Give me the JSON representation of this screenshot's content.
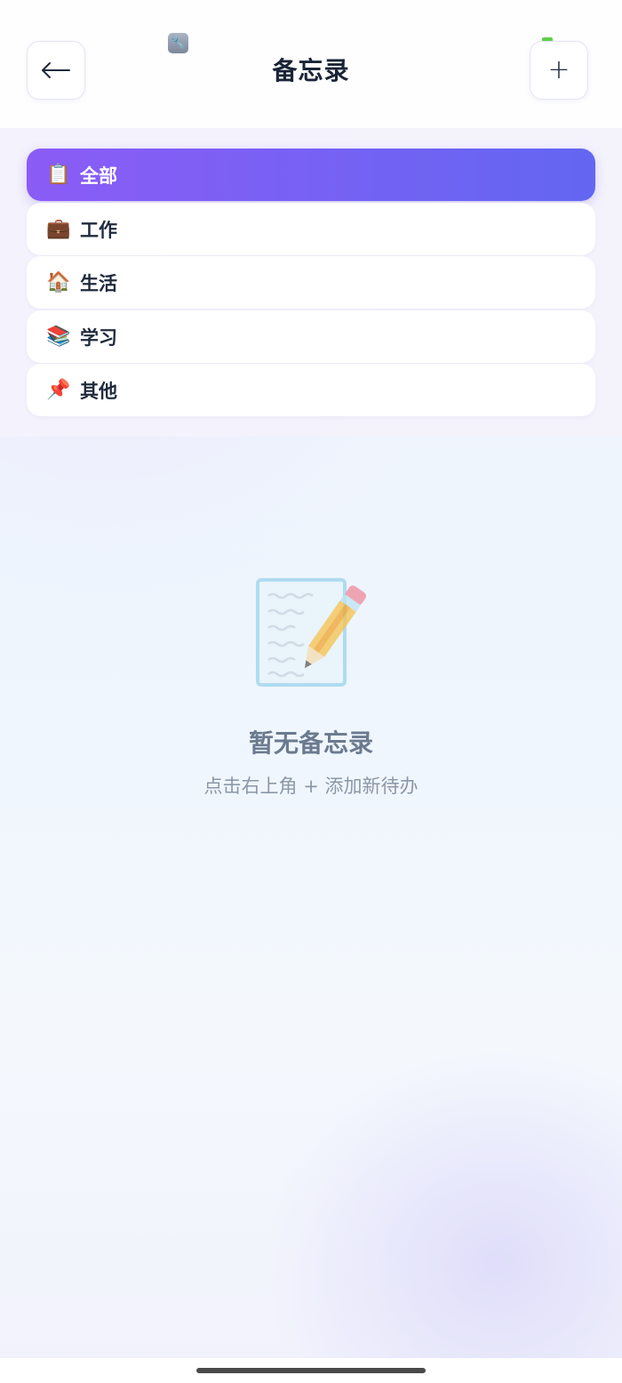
{
  "status_bar": {
    "tool_icon": "wrench-icon",
    "camera_indicator_color": "#5fd14b"
  },
  "header": {
    "title": "备忘录",
    "back_icon": "arrow-left-icon",
    "add_label": "+"
  },
  "categories": [
    {
      "emoji": "📋",
      "label": "全部",
      "active": true
    },
    {
      "emoji": "💼",
      "label": "工作",
      "active": false
    },
    {
      "emoji": "🏠",
      "label": "生活",
      "active": false
    },
    {
      "emoji": "📚",
      "label": "学习",
      "active": false
    },
    {
      "emoji": "📌",
      "label": "其他",
      "active": false
    }
  ],
  "empty_state": {
    "icon": "memo-pencil-icon",
    "title": "暂无备忘录",
    "hint": "点击右上角 + 添加新待办"
  },
  "colors": {
    "accent_start": "#8b5cf6",
    "accent_end": "#6366f1",
    "title_text": "#1a2436",
    "muted_text": "#8a97a8"
  }
}
